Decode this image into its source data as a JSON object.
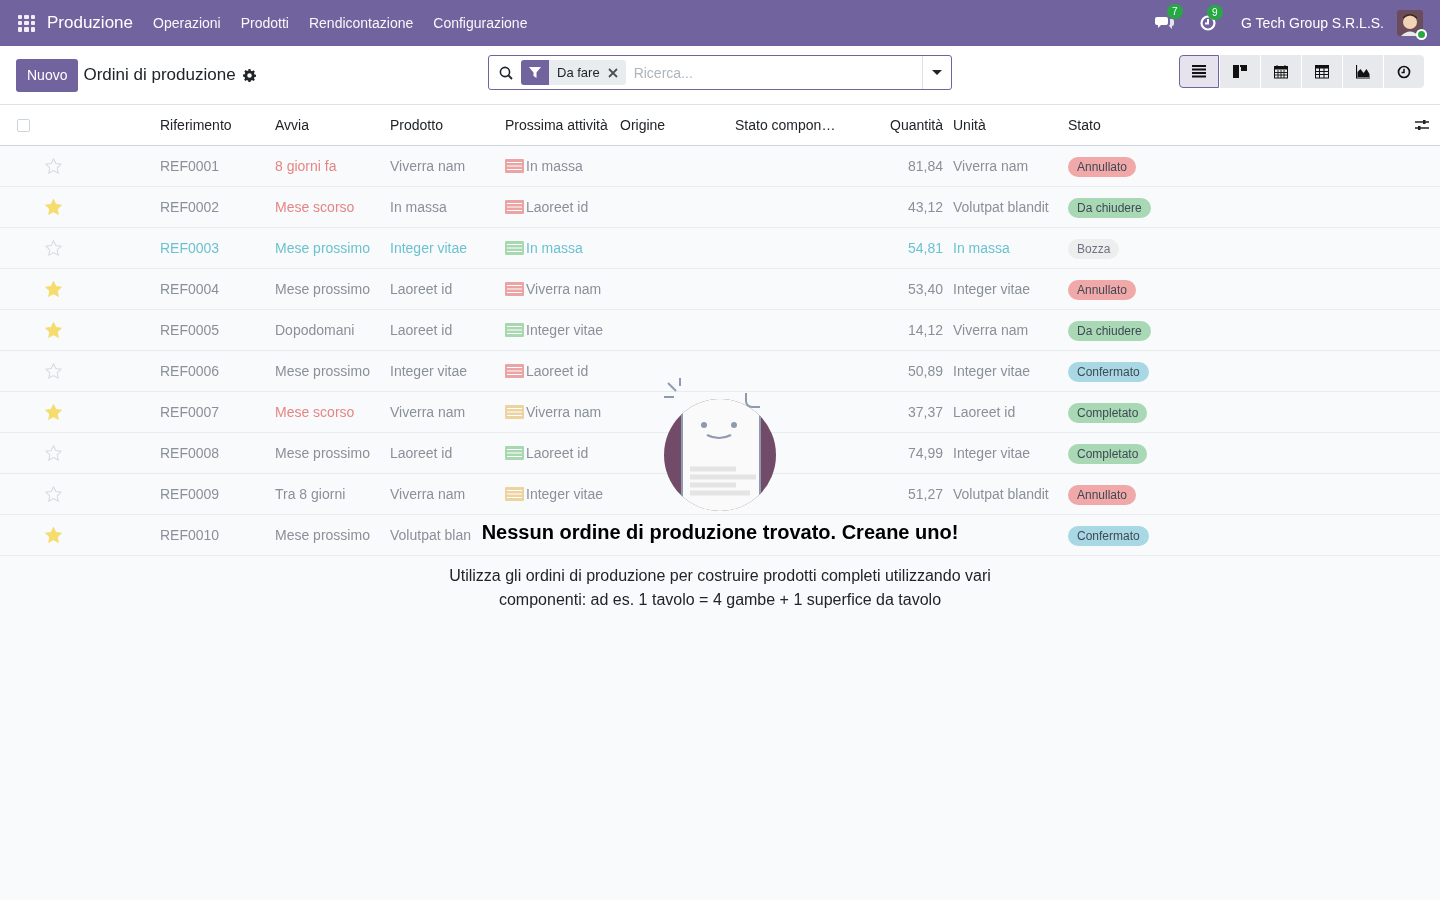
{
  "navbar": {
    "app": "Produzione",
    "menu": [
      "Operazioni",
      "Prodotti",
      "Rendicontazione",
      "Configurazione"
    ],
    "messages_count": "7",
    "activities_count": "9",
    "company": "G Tech Group S.R.L.S."
  },
  "control_panel": {
    "new_button": "Nuovo",
    "title": "Ordini di produzione",
    "facet": "Da fare",
    "search_placeholder": "Ricerca...",
    "views": [
      {
        "kind": "list",
        "selected": true
      },
      {
        "kind": "kanban",
        "selected": false
      },
      {
        "kind": "calendar",
        "selected": false
      },
      {
        "kind": "pivot",
        "selected": false
      },
      {
        "kind": "graph",
        "selected": false
      },
      {
        "kind": "activity",
        "selected": false
      }
    ]
  },
  "table": {
    "select_all_checked": false,
    "columns": [
      "Riferimento",
      "Avvia",
      "Prodotto",
      "Prossima attività",
      "Origine",
      "Stato compon…",
      "Quantità",
      "Unità",
      "Stato"
    ],
    "rows": [
      {
        "starred": false,
        "highlight": false,
        "reference": "REF0001",
        "start": "8 giorni fa",
        "start_late": true,
        "product": "Viverra nam",
        "activity": {
          "text": "In massa",
          "color": "#eba4a4"
        },
        "quantity": "81,84",
        "unit": "Viverra nam",
        "status": {
          "text": "Annullato",
          "color": "#f0a8a8"
        }
      },
      {
        "starred": true,
        "highlight": false,
        "reference": "REF0002",
        "start": "Mese scorso",
        "start_late": true,
        "product": "In massa",
        "activity": {
          "text": "Laoreet id",
          "color": "#eba4a4"
        },
        "quantity": "43,12",
        "unit": "Volutpat blandit",
        "status": {
          "text": "Da chiudere",
          "color": "#a8d8b4"
        }
      },
      {
        "starred": false,
        "highlight": true,
        "reference": "REF0003",
        "start": "Mese prossimo",
        "start_late": false,
        "product": "Integer vitae",
        "activity": {
          "text": "In massa",
          "color": "#a8d8b0"
        },
        "quantity": "54,81",
        "unit": "In massa",
        "status": {
          "text": "Bozza",
          "color": "#eeeeee"
        }
      },
      {
        "starred": true,
        "highlight": false,
        "reference": "REF0004",
        "start": "Mese prossimo",
        "start_late": false,
        "product": "Laoreet id",
        "activity": {
          "text": "Viverra nam",
          "color": "#eba4a4"
        },
        "quantity": "53,40",
        "unit": "Integer vitae",
        "status": {
          "text": "Annullato",
          "color": "#f0a8a8"
        }
      },
      {
        "starred": true,
        "highlight": false,
        "reference": "REF0005",
        "start": "Dopodomani",
        "start_late": false,
        "product": "Laoreet id",
        "activity": {
          "text": "Integer vitae",
          "color": "#a8d8b0"
        },
        "quantity": "14,12",
        "unit": "Viverra nam",
        "status": {
          "text": "Da chiudere",
          "color": "#a8d8b4"
        }
      },
      {
        "starred": false,
        "highlight": false,
        "reference": "REF0006",
        "start": "Mese prossimo",
        "start_late": false,
        "product": "Integer vitae",
        "activity": {
          "text": "Laoreet id",
          "color": "#eba4a4"
        },
        "quantity": "50,89",
        "unit": "Integer vitae",
        "status": {
          "text": "Confermato",
          "color": "#a8d8e4"
        }
      },
      {
        "starred": true,
        "highlight": false,
        "reference": "REF0007",
        "start": "Mese scorso",
        "start_late": true,
        "product": "Viverra nam",
        "activity": {
          "text": "Viverra nam",
          "color": "#ecd3a0"
        },
        "quantity": "37,37",
        "unit": "Laoreet id",
        "status": {
          "text": "Completato",
          "color": "#a8d8b4"
        }
      },
      {
        "starred": false,
        "highlight": false,
        "reference": "REF0008",
        "start": "Mese prossimo",
        "start_late": false,
        "product": "Laoreet id",
        "activity": {
          "text": "Laoreet id",
          "color": "#a8d8b0"
        },
        "quantity": "74,99",
        "unit": "Integer vitae",
        "status": {
          "text": "Completato",
          "color": "#a8d8b4"
        }
      },
      {
        "starred": false,
        "highlight": false,
        "reference": "REF0009",
        "start": "Tra 8 giorni",
        "start_late": false,
        "product": "Viverra nam",
        "activity": {
          "text": "Integer vitae",
          "color": "#ecd3a0"
        },
        "quantity": "51,27",
        "unit": "Volutpat blandit",
        "status": {
          "text": "Annullato",
          "color": "#f0a8a8"
        }
      },
      {
        "starred": true,
        "highlight": false,
        "reference": "REF0010",
        "start": "Mese prossimo",
        "start_late": false,
        "product": "Volutpat blan",
        "status": {
          "text": "Confermato",
          "color": "#a8d8e4"
        }
      }
    ]
  },
  "empty_state": {
    "title": "Nessun ordine di produzione trovato. Creane uno!",
    "text": "Utilizza gli ordini di produzione per costruire prodotti completi utilizzando vari componenti: ad es. 1 tavolo = 4 gambe + 1 superfice da tavolo"
  }
}
